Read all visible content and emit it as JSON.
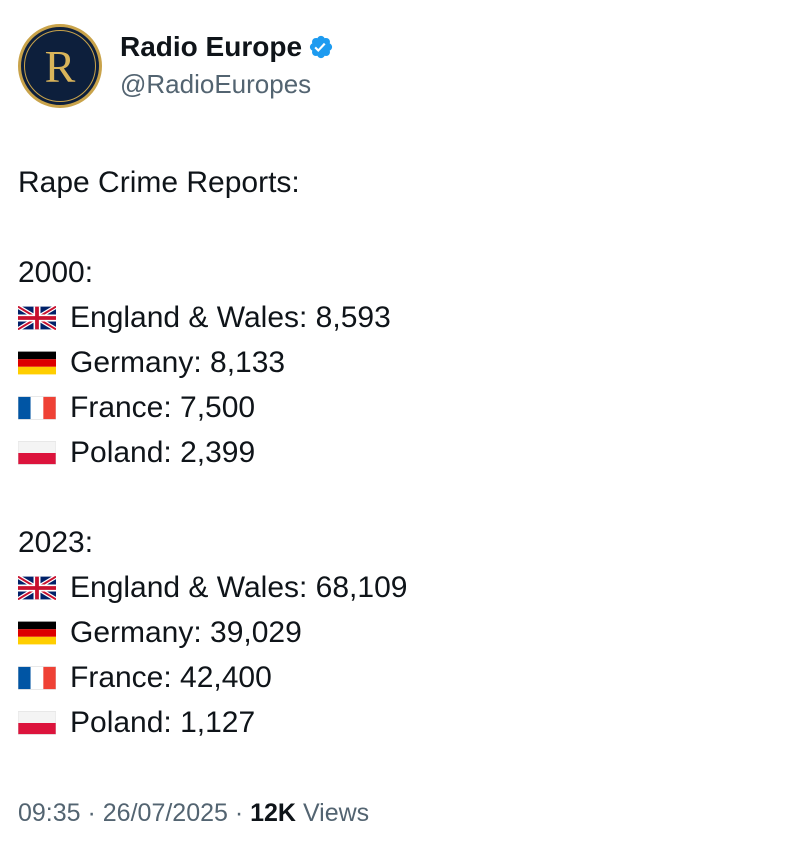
{
  "author": {
    "avatar_letter": "R",
    "name": "Radio Europe",
    "handle": "@RadioEuropes",
    "verified_icon": "verified-badge-icon",
    "avatar_colors": {
      "background": "#0d1f3c",
      "ring": "#c9a34a"
    }
  },
  "post": {
    "intro": "Rape Crime Reports:",
    "sections": [
      {
        "year": "2000:",
        "rows": [
          {
            "flag": "flag-uk-icon",
            "text": "England & Wales: 8,593"
          },
          {
            "flag": "flag-germany-icon",
            "text": "Germany: 8,133"
          },
          {
            "flag": "flag-france-icon",
            "text": "France: 7,500"
          },
          {
            "flag": "flag-poland-icon",
            "text": "Poland: 2,399"
          }
        ]
      },
      {
        "year": "2023:",
        "rows": [
          {
            "flag": "flag-uk-icon",
            "text": "England & Wales: 68,109"
          },
          {
            "flag": "flag-germany-icon",
            "text": "Germany: 39,029"
          },
          {
            "flag": "flag-france-icon",
            "text": "France: 42,400"
          },
          {
            "flag": "flag-poland-icon",
            "text": "Poland: 1,127"
          }
        ]
      }
    ]
  },
  "footer": {
    "time": "09:35",
    "separator": " · ",
    "date": "26/07/2025",
    "views_count": "12K",
    "views_label": " Views"
  },
  "colors": {
    "text": "#0f1419",
    "muted": "#536471",
    "verified": "#1d9bf0"
  }
}
